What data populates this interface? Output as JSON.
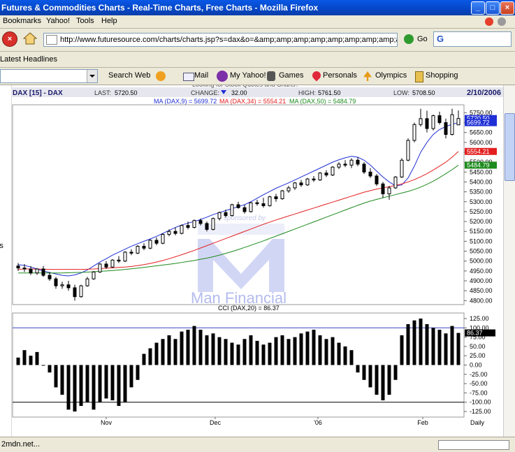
{
  "window": {
    "title": "Futures & Commodities Charts - Real-Time Charts, Free Charts - Mozilla Firefox",
    "minimize": "_",
    "maximize": "□",
    "close": "×"
  },
  "menu": [
    "Bookmarks",
    "Yahoo!",
    "Tools",
    "Help"
  ],
  "nav": {
    "url": "http://www.futuresource.com/charts/charts.jsp?s=dax&o=&amp;amp;amp;amp;amp;amp;amp;amp;amp;a=D",
    "go_label": "Go",
    "search_glyph": "G"
  },
  "bookmarks": {
    "latest_headlines": "Latest Headlines"
  },
  "yahoo_toolbar": {
    "search_web": "Search Web",
    "mail": "Mail",
    "my_yahoo": "My Yahoo!",
    "games": "Games",
    "personals": "Personals",
    "olympics": "Olympics",
    "shopping": "Shopping"
  },
  "page": {
    "cut_off_text": "Looking for Stock Quotes and Charts?",
    "side_headlines": "Latest Headlines"
  },
  "status": {
    "text": "2mdn.net..."
  },
  "chart_data": {
    "type": "candlestick",
    "symbol": "DAX [15] - DAX",
    "last_label": "LAST:",
    "last": "5720.50",
    "change_label": "CHANGE:",
    "change": "32.00",
    "high_label": "HIGH:",
    "high": "5761.50",
    "low_label": "LOW:",
    "low": "5708.50",
    "date": "2/10/2006",
    "watermark_top": "sponsored by",
    "watermark_brand": "Man Financial",
    "x_labels": [
      "Nov",
      "Dec",
      "'06",
      "Feb",
      "Daily"
    ],
    "price_axis": {
      "ticks": [
        4800,
        4850,
        4900,
        4950,
        5000,
        5050,
        5100,
        5150,
        5200,
        5250,
        5300,
        5350,
        5400,
        5450,
        5500,
        5550,
        5600,
        5650,
        5700,
        5750
      ],
      "tick_labels": [
        "4800.00",
        "4850.00",
        "4900.00",
        "4950.00",
        "5000.00",
        "5050.00",
        "5100.00",
        "5150.00",
        "5200.00",
        "5250.00",
        "5300.00",
        "5350.00",
        "5400.00",
        "5450.00",
        "5500.00",
        "5550.00",
        "5600.00",
        "5650.00",
        "5700.00",
        "5750.00"
      ],
      "ylim": [
        4780,
        5790
      ]
    },
    "series": [
      {
        "name": "MA (DAX,9)",
        "value": "5699.72",
        "color": "#1f2fd6",
        "values": [
          4982,
          4978,
          4970,
          4960,
          4950,
          4942,
          4935,
          4928,
          4925,
          4930,
          4940,
          4955,
          4975,
          4995,
          5012,
          5030,
          5045,
          5060,
          5075,
          5088,
          5100,
          5112,
          5125,
          5140,
          5155,
          5170,
          5182,
          5192,
          5200,
          5210,
          5222,
          5235,
          5245,
          5255,
          5265,
          5275,
          5285,
          5300,
          5318,
          5335,
          5352,
          5368,
          5382,
          5395,
          5410,
          5425,
          5440,
          5455,
          5470,
          5485,
          5500,
          5512,
          5522,
          5530,
          5525,
          5510,
          5485,
          5455,
          5425,
          5400,
          5380,
          5385,
          5420,
          5480,
          5550,
          5600,
          5640,
          5665,
          5680,
          5692,
          5699.72
        ]
      },
      {
        "name": "MA (DAX,34)",
        "value": "5554.21",
        "color": "#e32020",
        "values": [
          4958,
          4960,
          4960,
          4960,
          4959,
          4958,
          4958,
          4958,
          4958,
          4958,
          4958,
          4959,
          4960,
          4962,
          4964,
          4966,
          4968,
          4970,
          4973,
          4977,
          4982,
          4988,
          4995,
          5003,
          5012,
          5022,
          5032,
          5043,
          5054,
          5066,
          5078,
          5090,
          5102,
          5114,
          5126,
          5138,
          5150,
          5162,
          5174,
          5186,
          5197,
          5208,
          5218,
          5228,
          5238,
          5248,
          5258,
          5268,
          5278,
          5288,
          5298,
          5308,
          5318,
          5328,
          5338,
          5348,
          5356,
          5364,
          5370,
          5376,
          5382,
          5390,
          5400,
          5412,
          5426,
          5442,
          5460,
          5480,
          5500,
          5525,
          5554.21
        ]
      },
      {
        "name": "MA (DAX,50)",
        "value": "5484.79",
        "color": "#1c8a1c",
        "values": [
          4940,
          4940,
          4940,
          4940,
          4940,
          4940,
          4940,
          4940,
          4941,
          4942,
          4943,
          4944,
          4946,
          4948,
          4950,
          4952,
          4955,
          4958,
          4961,
          4964,
          4968,
          4972,
          4976,
          4980,
          4984,
          4988,
          4993,
          4998,
          5003,
          5009,
          5015,
          5022,
          5030,
          5039,
          5048,
          5058,
          5069,
          5080,
          5091,
          5102,
          5114,
          5126,
          5138,
          5150,
          5162,
          5174,
          5186,
          5198,
          5210,
          5222,
          5234,
          5246,
          5258,
          5270,
          5282,
          5293,
          5303,
          5312,
          5320,
          5328,
          5336,
          5344,
          5352,
          5362,
          5374,
          5388,
          5404,
          5422,
          5442,
          5462,
          5484.79
        ]
      }
    ],
    "candles": [
      [
        4975,
        4990,
        4950,
        4965
      ],
      [
        4965,
        4985,
        4945,
        4960
      ],
      [
        4960,
        4975,
        4930,
        4940
      ],
      [
        4940,
        4965,
        4930,
        4960
      ],
      [
        4960,
        4975,
        4920,
        4928
      ],
      [
        4928,
        4945,
        4900,
        4910
      ],
      [
        4910,
        4920,
        4860,
        4875
      ],
      [
        4875,
        4895,
        4860,
        4880
      ],
      [
        4880,
        4900,
        4850,
        4865
      ],
      [
        4865,
        4880,
        4800,
        4820
      ],
      [
        4820,
        4880,
        4815,
        4875
      ],
      [
        4875,
        4920,
        4870,
        4910
      ],
      [
        4910,
        4950,
        4905,
        4945
      ],
      [
        4945,
        4990,
        4940,
        4985
      ],
      [
        4985,
        5000,
        4960,
        4970
      ],
      [
        4970,
        5010,
        4965,
        5005
      ],
      [
        5005,
        5025,
        4990,
        5000
      ],
      [
        5000,
        5050,
        4995,
        5045
      ],
      [
        5045,
        5060,
        5030,
        5040
      ],
      [
        5040,
        5080,
        5035,
        5075
      ],
      [
        5075,
        5090,
        5055,
        5065
      ],
      [
        5065,
        5110,
        5060,
        5105
      ],
      [
        5105,
        5120,
        5080,
        5090
      ],
      [
        5090,
        5140,
        5085,
        5135
      ],
      [
        5135,
        5160,
        5125,
        5150
      ],
      [
        5150,
        5170,
        5130,
        5140
      ],
      [
        5140,
        5185,
        5135,
        5180
      ],
      [
        5180,
        5200,
        5160,
        5170
      ],
      [
        5170,
        5210,
        5165,
        5205
      ],
      [
        5205,
        5215,
        5180,
        5190
      ],
      [
        5190,
        5200,
        5150,
        5160
      ],
      [
        5160,
        5220,
        5155,
        5215
      ],
      [
        5215,
        5250,
        5205,
        5245
      ],
      [
        5245,
        5260,
        5220,
        5230
      ],
      [
        5230,
        5290,
        5225,
        5285
      ],
      [
        5285,
        5300,
        5265,
        5270
      ],
      [
        5270,
        5285,
        5240,
        5250
      ],
      [
        5250,
        5300,
        5245,
        5295
      ],
      [
        5295,
        5310,
        5280,
        5290
      ],
      [
        5290,
        5320,
        5270,
        5280
      ],
      [
        5280,
        5330,
        5275,
        5325
      ],
      [
        5325,
        5340,
        5300,
        5315
      ],
      [
        5315,
        5360,
        5310,
        5355
      ],
      [
        5355,
        5380,
        5345,
        5370
      ],
      [
        5370,
        5400,
        5360,
        5395
      ],
      [
        5395,
        5410,
        5375,
        5385
      ],
      [
        5385,
        5420,
        5380,
        5415
      ],
      [
        5415,
        5430,
        5400,
        5410
      ],
      [
        5410,
        5450,
        5405,
        5445
      ],
      [
        5445,
        5460,
        5425,
        5435
      ],
      [
        5435,
        5480,
        5430,
        5475
      ],
      [
        5475,
        5500,
        5465,
        5490
      ],
      [
        5490,
        5510,
        5475,
        5485
      ],
      [
        5485,
        5520,
        5470,
        5510
      ],
      [
        5510,
        5525,
        5480,
        5490
      ],
      [
        5490,
        5500,
        5440,
        5450
      ],
      [
        5450,
        5470,
        5420,
        5430
      ],
      [
        5430,
        5440,
        5380,
        5390
      ],
      [
        5390,
        5400,
        5320,
        5340
      ],
      [
        5340,
        5380,
        5310,
        5370
      ],
      [
        5370,
        5430,
        5365,
        5425
      ],
      [
        5425,
        5520,
        5420,
        5510
      ],
      [
        5510,
        5620,
        5505,
        5610
      ],
      [
        5610,
        5700,
        5600,
        5690
      ],
      [
        5690,
        5770,
        5680,
        5720
      ],
      [
        5720,
        5760,
        5650,
        5670
      ],
      [
        5670,
        5740,
        5660,
        5735
      ],
      [
        5735,
        5755,
        5690,
        5700
      ],
      [
        5700,
        5720,
        5620,
        5640
      ],
      [
        5640,
        5770,
        5635,
        5740
      ],
      [
        5688.5,
        5761.5,
        5708.5,
        5720.5
      ]
    ],
    "right_labels": [
      {
        "text": "5720.50",
        "value": 5720.5,
        "bg": "#1f2fd6",
        "fg": "#fff"
      },
      {
        "text": "5699.72",
        "value": 5699.72,
        "bg": "#1f2fd6",
        "fg": "#fff"
      },
      {
        "text": "5554.21",
        "value": 5554.21,
        "bg": "#e32020",
        "fg": "#fff"
      },
      {
        "text": "5484.79",
        "value": 5484.79,
        "bg": "#1c8a1c",
        "fg": "#fff"
      }
    ],
    "cci": {
      "title": "CCI (DAX,20) = 86.37",
      "value": "86.37",
      "ylim": [
        -140,
        140
      ],
      "ticks": [
        125,
        100,
        75,
        50,
        25,
        0,
        -25,
        -50,
        -75,
        -100,
        -125
      ],
      "tick_labels": [
        "125.00",
        "100.00",
        "75.00",
        "50.00",
        "25.00",
        "0.00",
        "-25.00",
        "-50.00",
        "-75.00",
        "-100.00",
        "-125.00"
      ],
      "reference_lines": [
        100,
        -100
      ],
      "values": [
        20,
        40,
        25,
        35,
        0,
        -20,
        -60,
        -80,
        -120,
        -125,
        -110,
        -100,
        -120,
        -100,
        -90,
        -95,
        -110,
        -100,
        -60,
        -40,
        30,
        45,
        60,
        70,
        80,
        70,
        90,
        95,
        105,
        95,
        80,
        85,
        75,
        70,
        60,
        55,
        70,
        80,
        65,
        55,
        60,
        75,
        80,
        70,
        75,
        85,
        90,
        95,
        80,
        70,
        75,
        60,
        50,
        40,
        -20,
        -40,
        -60,
        -80,
        -95,
        -80,
        -40,
        80,
        110,
        120,
        125,
        110,
        100,
        95,
        85,
        105,
        86.37
      ]
    }
  }
}
